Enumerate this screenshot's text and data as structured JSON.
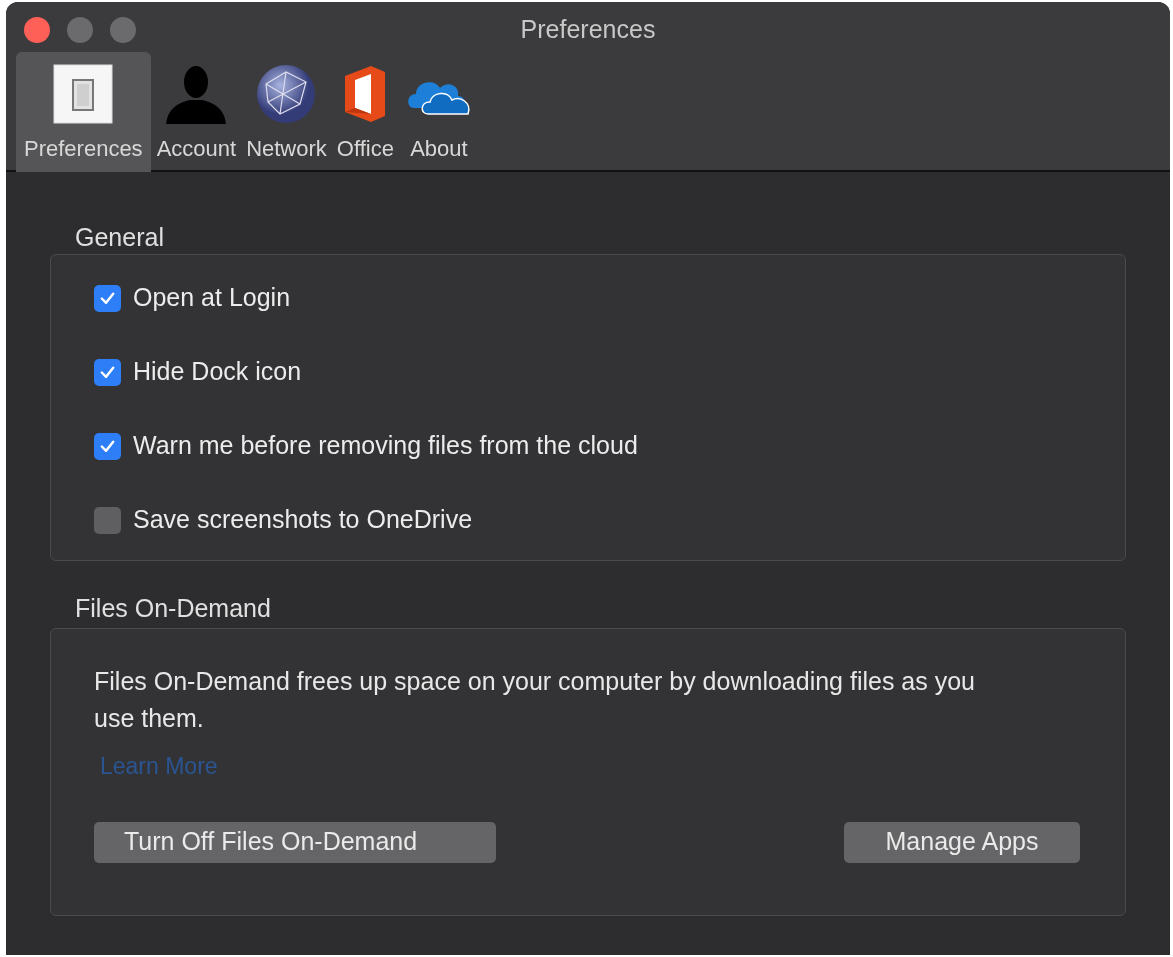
{
  "window": {
    "title": "Preferences"
  },
  "tabs": [
    {
      "label": "Preferences",
      "kind": "switch",
      "selected": true
    },
    {
      "label": "Account",
      "kind": "person",
      "selected": false
    },
    {
      "label": "Network",
      "kind": "globe",
      "selected": false
    },
    {
      "label": "Office",
      "kind": "office",
      "selected": false
    },
    {
      "label": "About",
      "kind": "cloud",
      "selected": false
    }
  ],
  "general": {
    "title": "General",
    "options": [
      {
        "label": "Open at Login",
        "checked": true
      },
      {
        "label": "Hide Dock icon",
        "checked": true
      },
      {
        "label": "Warn me before removing files from the cloud",
        "checked": true
      },
      {
        "label": "Save screenshots to OneDrive",
        "checked": false
      }
    ]
  },
  "files_on_demand": {
    "title": "Files On-Demand",
    "description": "Files On-Demand frees up space on your computer by downloading files as you use them.",
    "link": "Learn More",
    "buttons": [
      "Turn Off Files On-Demand",
      "Manage Apps"
    ]
  }
}
